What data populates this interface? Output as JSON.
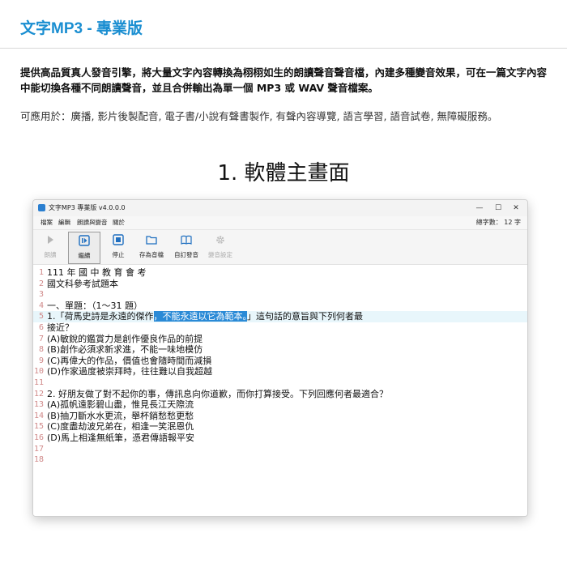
{
  "header": {
    "title": "文字MP3 - 專業版"
  },
  "intro": {
    "text": "提供高品質真人發音引擎，將大量文字內容轉換為栩栩如生的朗讀聲音聲音檔，內建多種變音效果，可在一篇文字內容中能切換各種不同朗讀聲音，並且合併輸出為單一個 MP3 或 WAV 聲音檔案。",
    "usage": "可應用於：廣播, 影片後製配音, 電子書/小說有聲書製作, 有聲內容導覽, 語言學習, 語音試卷, 無障礙服務。"
  },
  "section": {
    "title": "1. 軟體主畫面"
  },
  "window": {
    "title": "文字MP3 專業版 v4.0.0.0",
    "controls": {
      "minimize": "—",
      "maximize": "☐",
      "close": "✕"
    },
    "menu": [
      "檔案",
      "編輯",
      "朗讀與變音",
      "關於"
    ],
    "word_count": "總字數： 12 字",
    "toolbar": [
      {
        "label": "朗讀",
        "icon": "play-icon",
        "disabled": true
      },
      {
        "label": "繼續",
        "icon": "resume-icon",
        "disabled": false
      },
      {
        "label": "停止",
        "icon": "stop-icon",
        "disabled": false
      },
      {
        "label": "存為音檔",
        "icon": "folder-icon",
        "disabled": false
      },
      {
        "label": "自訂發音",
        "icon": "book-icon",
        "disabled": false
      },
      {
        "label": "變音設定",
        "icon": "gear-icon",
        "disabled": true
      }
    ],
    "editor": {
      "current_line": 5,
      "lines": [
        {
          "n": "1",
          "text": "111 年 國 中 教 育 會 考"
        },
        {
          "n": "2",
          "text": "國文科參考試題本"
        },
        {
          "n": "3",
          "text": ""
        },
        {
          "n": "4",
          "text": "一、單題：（1～31 題）"
        },
        {
          "n": "5",
          "pre": "1.「荷馬史詩是永遠的傑作",
          "sel": "，不能永遠以它為範本。",
          "post": "」這句話的意旨與下列何者最"
        },
        {
          "n": "6",
          "text": "接近？"
        },
        {
          "n": "7",
          "text": "(A)敏銳的鑑賞力是創作優良作品的前提"
        },
        {
          "n": "8",
          "text": "(B)創作必須求新求進，不能一味地模仿"
        },
        {
          "n": "9",
          "text": "(C)再偉大的作品，價值也會隨時間而減損"
        },
        {
          "n": "10",
          "text": "(D)作家過度被崇拜時，往往難以自我超越"
        },
        {
          "n": "11",
          "text": ""
        },
        {
          "n": "12",
          "text": "2. 好朋友做了對不起你的事，傳訊息向你道歉，而你打算接受。下列回應何者最適合？"
        },
        {
          "n": "13",
          "text": "(A)孤帆遠影碧山盡，惟見長江天際流"
        },
        {
          "n": "14",
          "text": "(B)抽刀斷水水更流，舉杯銷愁愁更愁"
        },
        {
          "n": "15",
          "text": "(C)度盡劫波兄弟在，相逢一笑泯恩仇"
        },
        {
          "n": "16",
          "text": "(D)馬上相逢無紙筆，憑君傳語報平安"
        },
        {
          "n": "17",
          "text": ""
        },
        {
          "n": "18",
          "text": ""
        }
      ]
    }
  },
  "colors": {
    "accent": "#1a8ed1",
    "selection": "#2a8ad6",
    "line_highlight": "#e8f6fb",
    "line_numbers": "#d08a8a"
  }
}
